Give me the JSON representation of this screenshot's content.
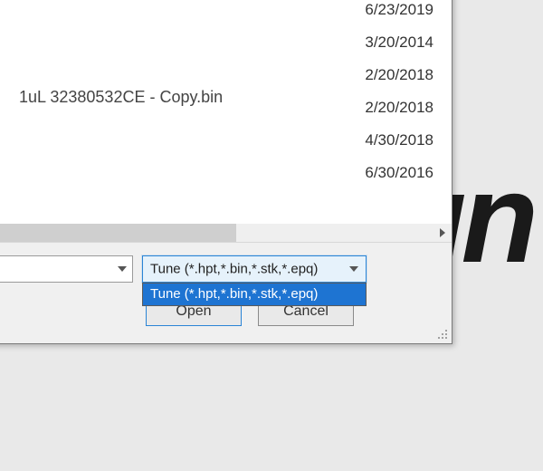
{
  "dates": [
    "6/23/2019",
    "3/20/2014",
    "2/20/2018",
    "2/20/2018",
    "4/30/2018",
    "6/30/2016"
  ],
  "truncated_filename": "1uL 32380532CE - Copy.bin",
  "filter": {
    "selected": "Tune (*.hpt,*.bin,*.stk,*.epq)",
    "options": [
      "Tune (*.hpt,*.bin,*.stk,*.epq)"
    ]
  },
  "buttons": {
    "open": "Open",
    "cancel": "Cancel"
  },
  "bg_text": "un"
}
